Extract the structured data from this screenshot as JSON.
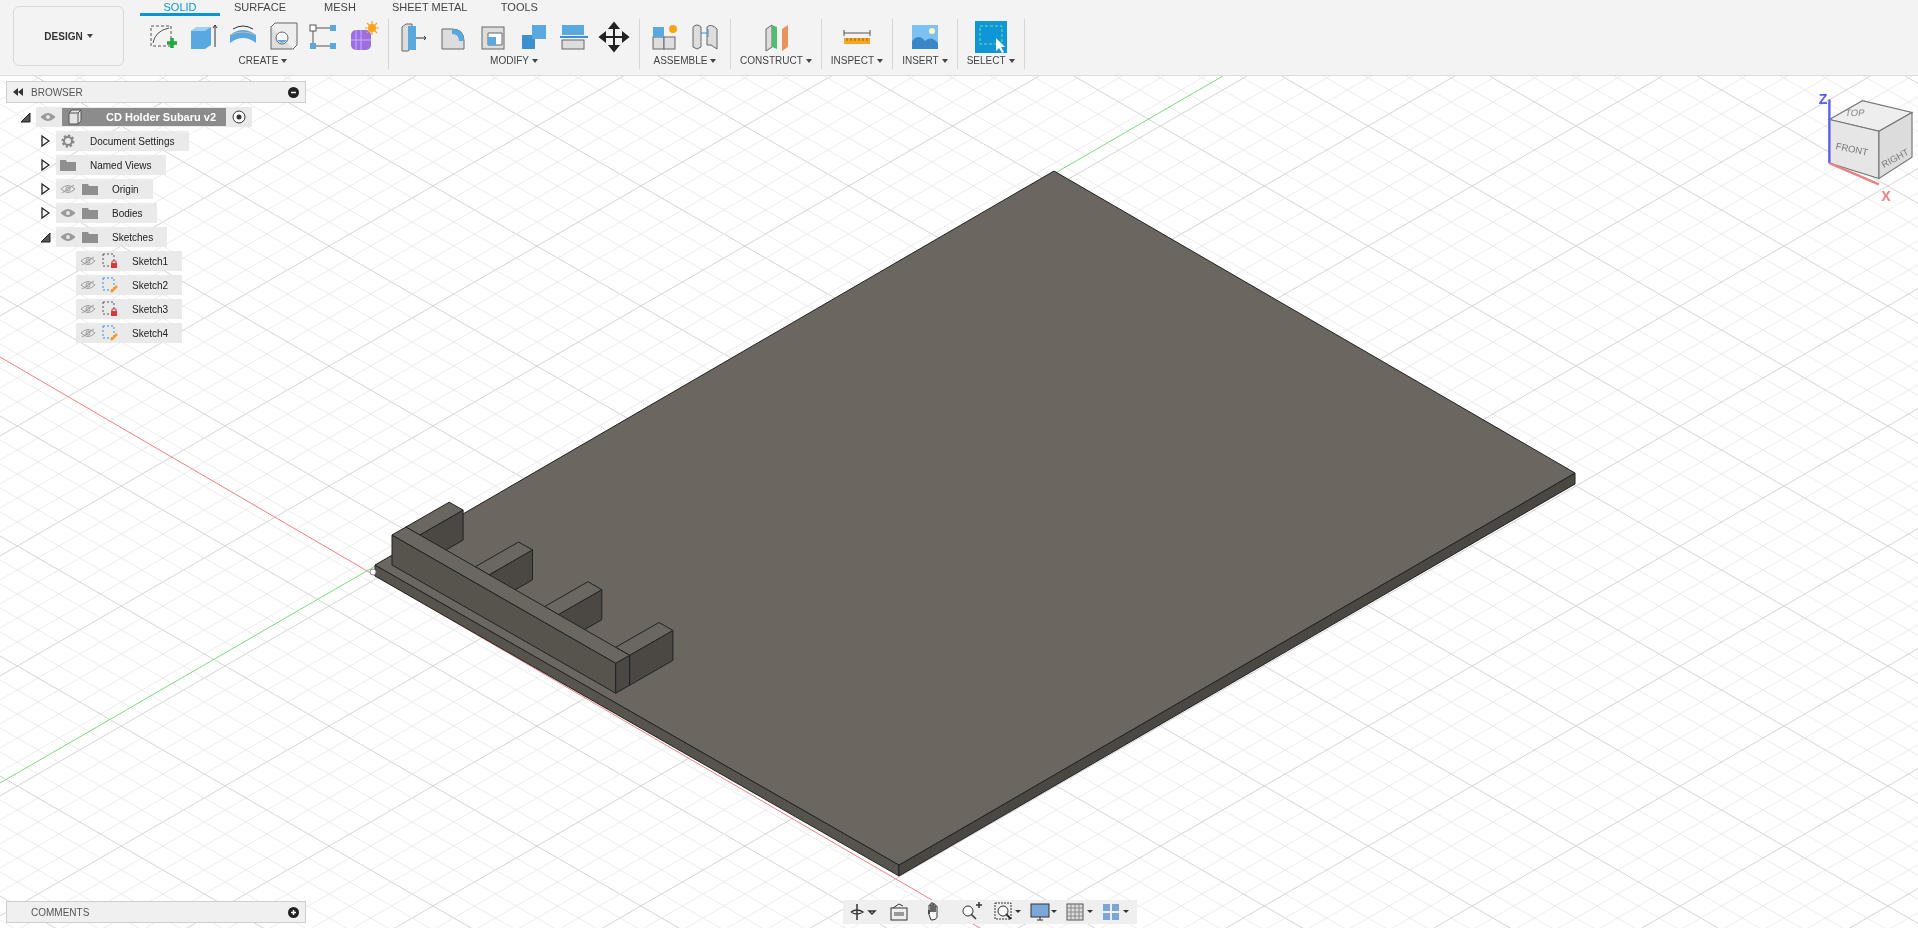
{
  "toolbar": {
    "workspace": "DESIGN",
    "tabs": [
      {
        "label": "SOLID",
        "selected": true
      },
      {
        "label": "SURFACE",
        "selected": false
      },
      {
        "label": "MESH",
        "selected": false
      },
      {
        "label": "SHEET METAL",
        "selected": false
      },
      {
        "label": "TOOLS",
        "selected": false
      }
    ],
    "groups": [
      {
        "label": "CREATE"
      },
      {
        "label": "MODIFY"
      },
      {
        "label": "ASSEMBLE"
      },
      {
        "label": "CONSTRUCT"
      },
      {
        "label": "INSPECT"
      },
      {
        "label": "INSERT"
      },
      {
        "label": "SELECT"
      }
    ]
  },
  "browser": {
    "title": "BROWSER",
    "tree": [
      {
        "kind": "component",
        "label": "CD Holder Subaru v2",
        "expanded": true,
        "visible": true,
        "active": true,
        "children": [
          {
            "kind": "settings",
            "label": "Document Settings",
            "expanded": false
          },
          {
            "kind": "folder",
            "label": "Named Views",
            "expanded": false
          },
          {
            "kind": "folder",
            "label": "Origin",
            "expanded": false,
            "visible": false
          },
          {
            "kind": "folder",
            "label": "Bodies",
            "expanded": false,
            "visible": true
          },
          {
            "kind": "folder",
            "label": "Sketches",
            "expanded": true,
            "visible": true,
            "children": [
              {
                "kind": "sketch",
                "label": "Sketch1",
                "visible": false,
                "locked": true
              },
              {
                "kind": "sketch",
                "label": "Sketch2",
                "visible": false,
                "locked": false
              },
              {
                "kind": "sketch",
                "label": "Sketch3",
                "visible": false,
                "locked": true
              },
              {
                "kind": "sketch",
                "label": "Sketch4",
                "visible": false,
                "locked": false
              }
            ]
          }
        ]
      }
    ]
  },
  "viewcube": {
    "faces": [
      "TOP",
      "FRONT",
      "RIGHT"
    ],
    "axes": [
      "Z",
      "X"
    ]
  },
  "comments": {
    "title": "COMMENTS"
  }
}
